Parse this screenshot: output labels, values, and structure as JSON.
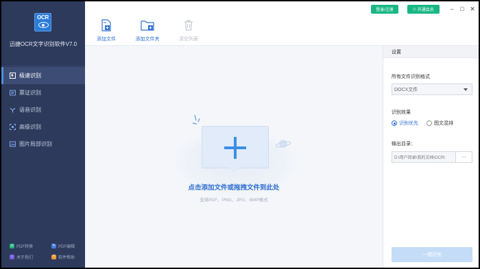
{
  "app": {
    "logo_text": "OCR",
    "title": "迅捷OCR文字识别软件V7.0"
  },
  "header": {
    "login_label": "登录/注册",
    "vip_label": "开通会员",
    "window_controls": [
      "minimize-icon",
      "maximize-icon",
      "close-icon"
    ]
  },
  "sidebar": {
    "items": [
      {
        "label": "极速识别",
        "icon": "lightning-icon",
        "active": true
      },
      {
        "label": "票证识别",
        "icon": "ticket-icon",
        "active": false
      },
      {
        "label": "语音识别",
        "icon": "microphone-icon",
        "active": false
      },
      {
        "label": "高级识别",
        "icon": "scan-icon",
        "active": false
      },
      {
        "label": "图片局部识别",
        "icon": "image-crop-icon",
        "active": false
      }
    ],
    "bottom_links": [
      {
        "label": "PDF转换",
        "icon": "pdf-convert-icon",
        "color": "#1fb27a"
      },
      {
        "label": "PDF编辑",
        "icon": "pdf-edit-icon",
        "color": "#4a7be0"
      },
      {
        "label": "关于我们",
        "icon": "info-icon",
        "color": "#7b5ce0"
      },
      {
        "label": "软件帮助",
        "icon": "help-icon",
        "color": "#f29a3c"
      }
    ]
  },
  "toolbar": {
    "add_file": "添加文件",
    "add_folder": "添加文件夹",
    "clear_list": "清空列表"
  },
  "main": {
    "drop_title": "点击添加文件或拖拽文件到此处",
    "drop_subtitle": "支持PDF、PNG、JPG、BMP格式"
  },
  "settings": {
    "title": "设置",
    "format_label": "所有文件识别格式",
    "format_value": "DOCX文件",
    "effect_label": "识别效果",
    "effect_options": [
      {
        "label": "识别优先",
        "selected": true
      },
      {
        "label": "图文混排",
        "selected": false
      }
    ],
    "output_label": "输出目录：",
    "output_path": "D:\\用户目录\\我的文档\\OCR\\",
    "browse_label": "···",
    "start_button": "一键识别"
  },
  "colors": {
    "sidebar_bg": "#2d3a5c",
    "accent_blue": "#2f6fd0",
    "accent_green": "#19b784",
    "disabled_button": "#c5dcf7"
  }
}
